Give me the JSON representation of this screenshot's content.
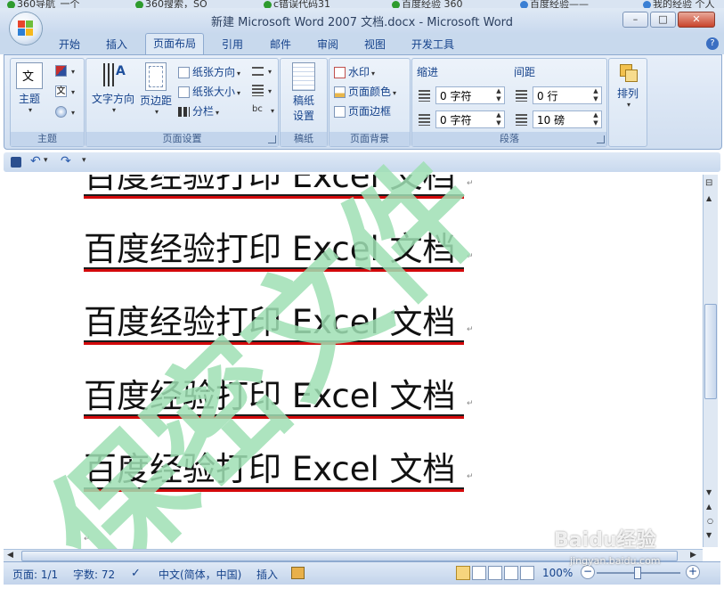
{
  "browser_tabs": [
    {
      "label": "360导航_一个",
      "color": "#2e9b2e"
    },
    {
      "label": "360搜索，SO",
      "color": "#2e9b2e"
    },
    {
      "label": "c错误代码31",
      "color": "#2e9b2e"
    },
    {
      "label": "百度经验 360",
      "color": "#2e9b2e"
    },
    {
      "label": "百度经验——",
      "color": "#3a7fd4"
    },
    {
      "label": "我的经验 个人",
      "color": "#3a7fd4"
    }
  ],
  "window": {
    "title": "新建 Microsoft Word 2007 文档.docx - Microsoft Word",
    "minimize": "–",
    "maximize": "□",
    "close": "✕"
  },
  "ribbon_tabs": [
    "开始",
    "插入",
    "页面布局",
    "引用",
    "邮件",
    "审阅",
    "视图",
    "开发工具"
  ],
  "active_tab": "页面布局",
  "help": "?",
  "groups": {
    "theme": {
      "label": "主题",
      "button": "主题"
    },
    "page_setup": {
      "label": "页面设置",
      "text_direction": "文字方向",
      "margins": "页边距",
      "orientation": "纸张方向",
      "size": "纸张大小",
      "columns": "分栏"
    },
    "draft": {
      "label": "稿纸",
      "button_line1": "稿纸",
      "button_line2": "设置"
    },
    "background": {
      "label": "页面背景",
      "watermark": "水印",
      "page_color": "页面颜色",
      "page_borders": "页面边框"
    },
    "paragraph": {
      "label": "段落",
      "indent_title": "缩进",
      "spacing_title": "间距",
      "indent_left": "0 字符",
      "indent_right": "0 字符",
      "spacing_before": "0 行",
      "spacing_after": "10 磅"
    },
    "arrange": {
      "label": "",
      "button": "排列"
    }
  },
  "document": {
    "lines": [
      "百度经验打印 Excel 文档",
      "百度经验打印 Excel 文档",
      "百度经验打印 Excel 文档",
      "百度经验打印 Excel 文档",
      "百度经验打印 Excel 文档"
    ],
    "watermark_text": "保密文件",
    "watermark_color": "#9fe0b4",
    "underline_color": "#d4090b"
  },
  "status": {
    "page": "页面: 1/1",
    "words": "字数: 72",
    "language": "中文(简体，中国)",
    "insert_mode": "插入",
    "zoom": "100%"
  },
  "site_watermark": {
    "logo": "Baidu经验",
    "url": "jingyan.baidu.com"
  }
}
